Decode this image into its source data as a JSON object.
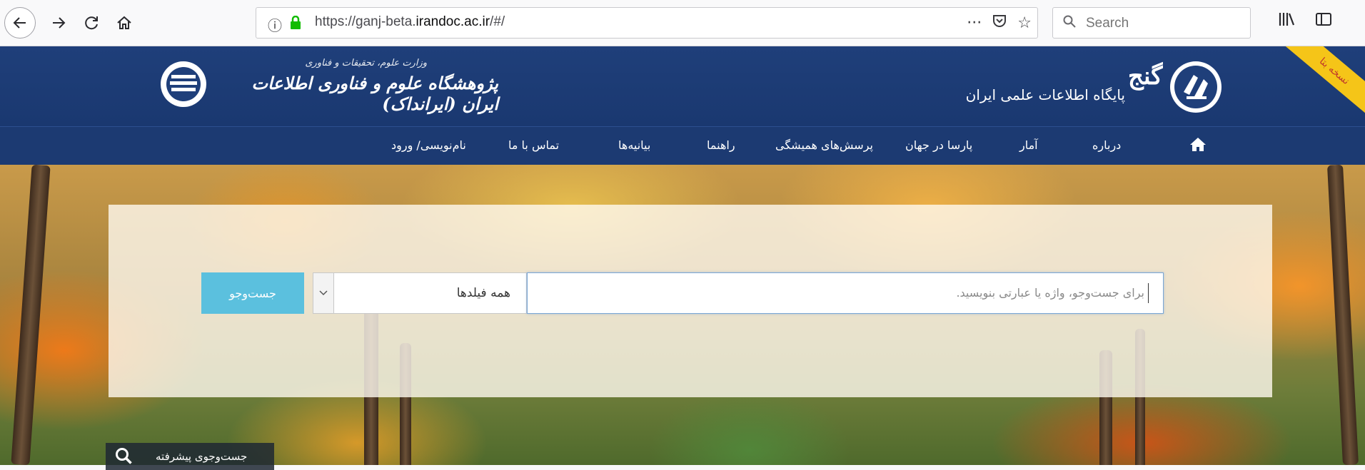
{
  "browser": {
    "url_prefix": "https://ganj-beta.",
    "url_domain": "irandoc.ac.ir",
    "url_suffix": "/#/",
    "url_menu_glyph": "···",
    "search_placeholder": "Search",
    "icons": [
      "back-icon",
      "forward-icon",
      "reload-icon",
      "home-icon",
      "info-icon",
      "lock-icon",
      "pocket-icon",
      "bookmark-star-icon",
      "search-icon",
      "library-icon",
      "sidebar-icon"
    ]
  },
  "header": {
    "ribbon": "نسخه بتا",
    "ministry": "وزارت علوم، تحقیقات و فناوری",
    "institute": "پژوهشگاه علوم و فناوری اطلاعات ایران (ایرانداک)",
    "ganj_title": "گنج",
    "ganj_subtitle": "پایگاه اطلاعات علمی ایران"
  },
  "nav": {
    "items": [
      "درباره",
      "آمار",
      "پارسا در جهان",
      "پرسش‌های همیشگی",
      "راهنما",
      "بیانیه‌ها",
      "تماس با ما",
      "نام‌نویسی/ ورود"
    ]
  },
  "search": {
    "button_label": "جست‌وجو",
    "field_value": "همه فیلدها",
    "query_placeholder": "برای جست‌وجو، واژه یا عبارتی بنویسید.",
    "advanced_label": "جست‌وجوی پیشرفته"
  },
  "colors": {
    "header_bg": "#1f3f7a",
    "nav_bg": "#1c3a72",
    "search_button": "#5bc0de",
    "ribbon": "#f5c518"
  }
}
